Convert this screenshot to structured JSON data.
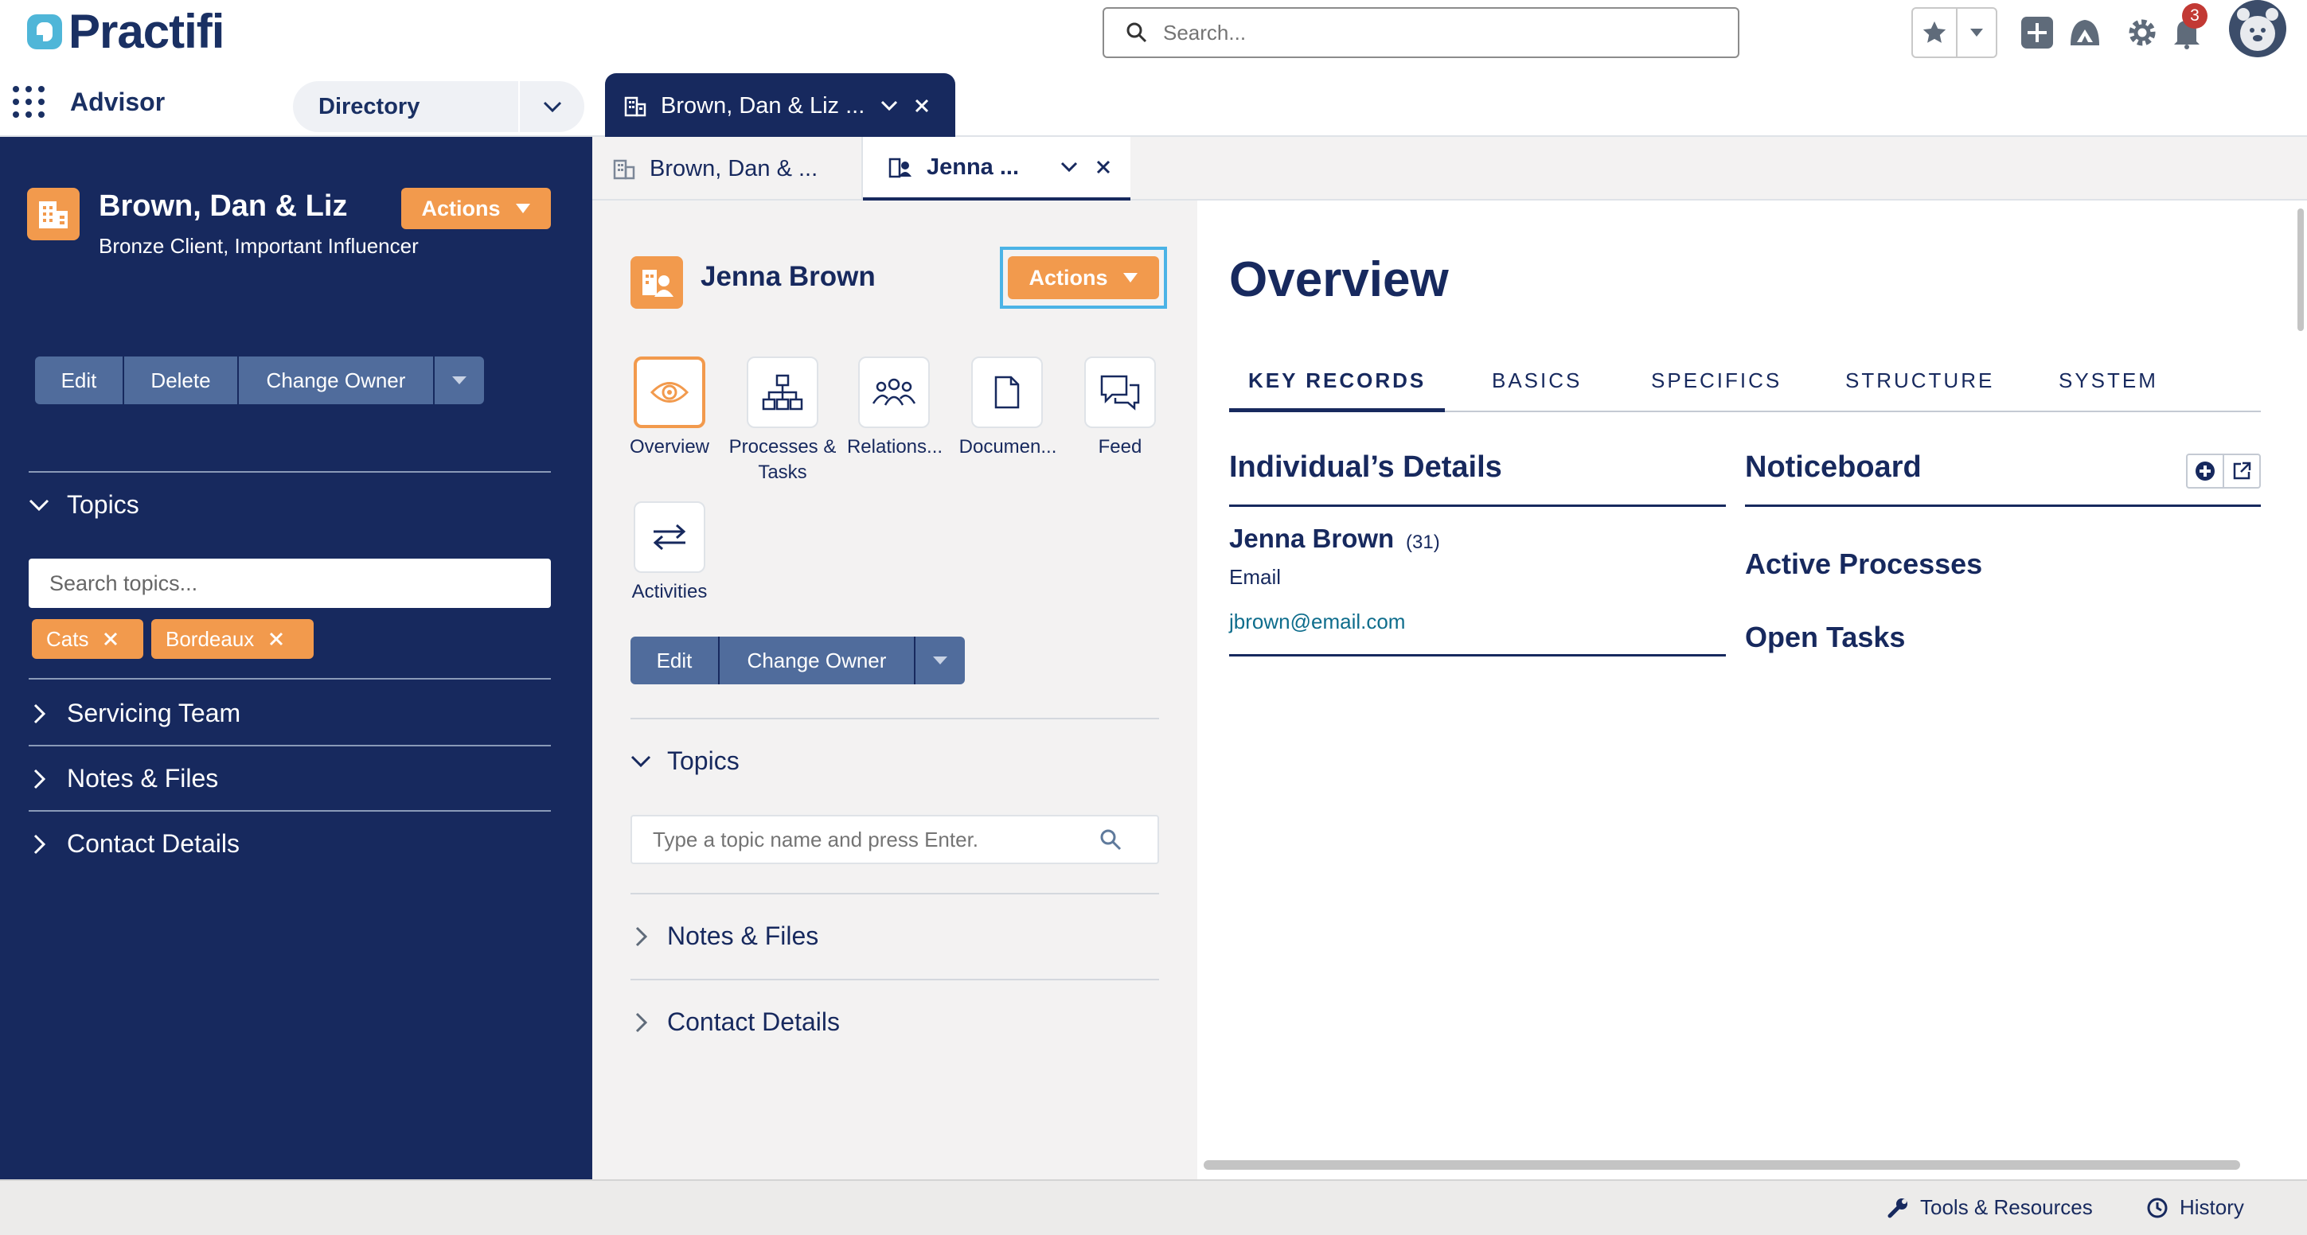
{
  "header": {
    "brand": "Practifi",
    "search_placeholder": "Search...",
    "notifications_count": "3"
  },
  "navbar": {
    "app_name": "Advisor",
    "directory_label": "Directory",
    "workspace_tab": "Brown, Dan & Liz ..."
  },
  "sidebar": {
    "record_name": "Brown, Dan & Liz",
    "record_subtitle": "Bronze Client, Important Influencer",
    "actions_label": "Actions",
    "buttons": [
      "Edit",
      "Delete",
      "Change Owner"
    ],
    "topics": {
      "label": "Topics",
      "search_placeholder": "Search topics...",
      "chips": [
        "Cats",
        "Bordeaux"
      ]
    },
    "sections": [
      "Servicing Team",
      "Notes & Files",
      "Contact Details"
    ]
  },
  "subtabs": {
    "tab1": "Brown, Dan & ...",
    "tab2": "Jenna ..."
  },
  "middle": {
    "record_name": "Jenna Brown",
    "actions_label": "Actions",
    "tiles": [
      {
        "label": "Overview",
        "icon": "eye-icon"
      },
      {
        "label": "Processes & Tasks",
        "icon": "hierarchy-icon"
      },
      {
        "label": "Relations...",
        "icon": "people-icon"
      },
      {
        "label": "Documen...",
        "icon": "document-icon"
      },
      {
        "label": "Feed",
        "icon": "chat-icon"
      },
      {
        "label": "Activities",
        "icon": "swap-icon"
      }
    ],
    "buttons": [
      "Edit",
      "Change Owner"
    ],
    "topics_label": "Topics",
    "topic_placeholder": "Type a topic name and press Enter.",
    "sections": [
      "Notes & Files",
      "Contact Details"
    ]
  },
  "content": {
    "title": "Overview",
    "tabs": [
      "KEY RECORDS",
      "BASICS",
      "SPECIFICS",
      "STRUCTURE",
      "SYSTEM"
    ],
    "individual": {
      "heading": "Individual’s Details",
      "name": "Jenna Brown",
      "age": "(31)",
      "email_label": "Email",
      "email": "jbrown@email.com"
    },
    "noticeboard": "Noticeboard",
    "active_processes": "Active Processes",
    "open_tasks": "Open Tasks"
  },
  "footer": {
    "tools": "Tools & Resources",
    "history": "History"
  },
  "colors": {
    "navy": "#17295e",
    "orange": "#f29a4d",
    "highlight": "#4bb3e6",
    "button_blue": "#506c9c"
  }
}
